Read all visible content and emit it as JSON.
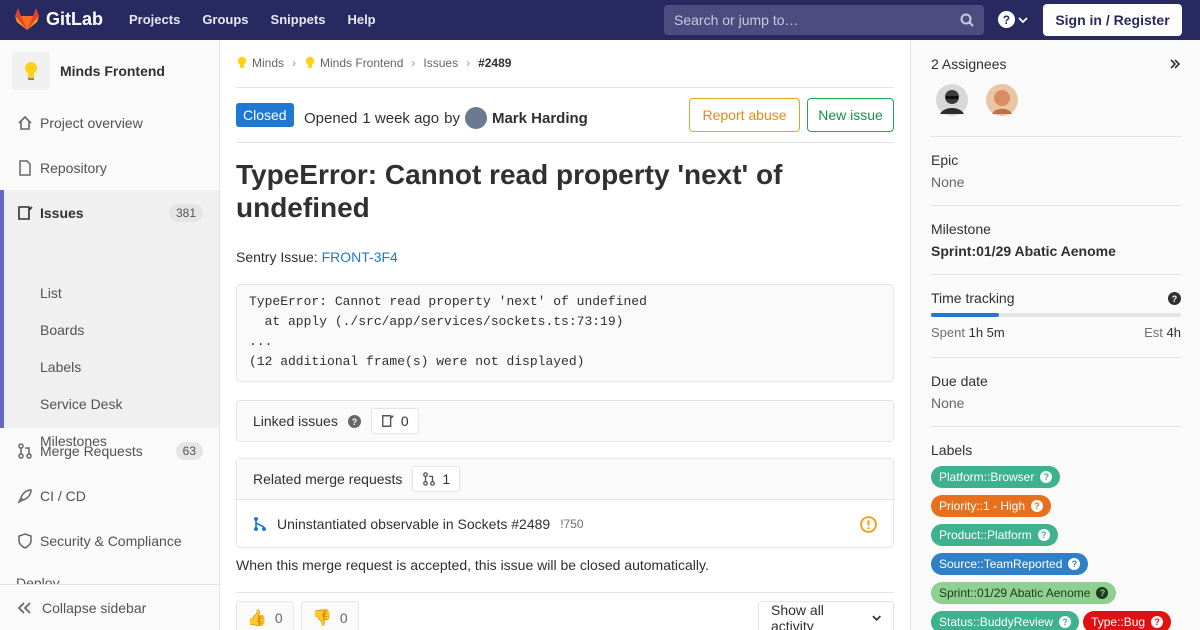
{
  "topbar": {
    "brand": "GitLab",
    "nav": [
      "Projects",
      "Groups",
      "Snippets",
      "Help"
    ],
    "search_placeholder": "Search or jump to…",
    "signin": "Sign in / Register"
  },
  "sidebar": {
    "project_name": "Minds Frontend",
    "items": [
      {
        "label": "Project overview",
        "icon": "home-icon"
      },
      {
        "label": "Repository",
        "icon": "file-icon"
      },
      {
        "label": "Issues",
        "icon": "issues-icon",
        "badge": "381"
      },
      {
        "label": "Merge Requests",
        "icon": "merge-icon",
        "badge": "63"
      },
      {
        "label": "CI / CD",
        "icon": "rocket-icon"
      },
      {
        "label": "Security & Compliance",
        "icon": "shield-icon"
      },
      {
        "label": "Deploy",
        "icon": "deploy-icon"
      }
    ],
    "sub_items": [
      "List",
      "Boards",
      "Labels",
      "Service Desk",
      "Milestones"
    ],
    "collapse": "Collapse sidebar"
  },
  "breadcrumb": [
    "Minds",
    "Minds Frontend",
    "Issues",
    "#2489"
  ],
  "issue": {
    "status": "Closed",
    "opened_prefix": "Opened",
    "opened_time": "1 week ago",
    "by": "by",
    "author": "Mark Harding",
    "report_abuse": "Report abuse",
    "new_issue": "New issue",
    "title": "TypeError: Cannot read property 'next' of undefined",
    "sentry_label": "Sentry Issue:",
    "sentry_link": "FRONT-3F4",
    "code": "TypeError: Cannot read property 'next' of undefined\n  at apply (./src/app/services/sockets.ts:73:19)\n...\n(12 additional frame(s) were not displayed)",
    "linked_label": "Linked issues",
    "linked_count": "0",
    "related_label": "Related merge requests",
    "related_count": "1",
    "mr_title": "Uninstantiated observable in Sockets #2489",
    "mr_ref": "!750",
    "auto_close": "When this merge request is accepted, this issue will be closed automatically.",
    "thumbs_up": "0",
    "thumbs_down": "0",
    "activity": "Show all activity"
  },
  "right": {
    "assignees": "2 Assignees",
    "epic_label": "Epic",
    "epic_value": "None",
    "milestone_label": "Milestone",
    "milestone_value": "Sprint:01/29 Abatic Aenome",
    "time_label": "Time tracking",
    "time_progress": 0.27,
    "spent_label": "Spent",
    "spent_value": "1h 5m",
    "est_label": "Est",
    "est_value": "4h",
    "due_label": "Due date",
    "due_value": "None",
    "labels_label": "Labels",
    "labels": [
      {
        "text": "Platform::Browser",
        "color": "#3db28c"
      },
      {
        "text": "Priority::1 - High",
        "color": "#e8701c"
      },
      {
        "text": "Product::Platform",
        "color": "#3db28c"
      },
      {
        "text": "Source::TeamReported",
        "color": "#2f80c7"
      },
      {
        "text": "Sprint::01/29 Abatic Aenome",
        "color": "#8fcf8f"
      },
      {
        "text": "Status::BuddyReview",
        "color": "#3db28c"
      },
      {
        "text": "Type::Bug",
        "color": "#e01111"
      }
    ]
  }
}
